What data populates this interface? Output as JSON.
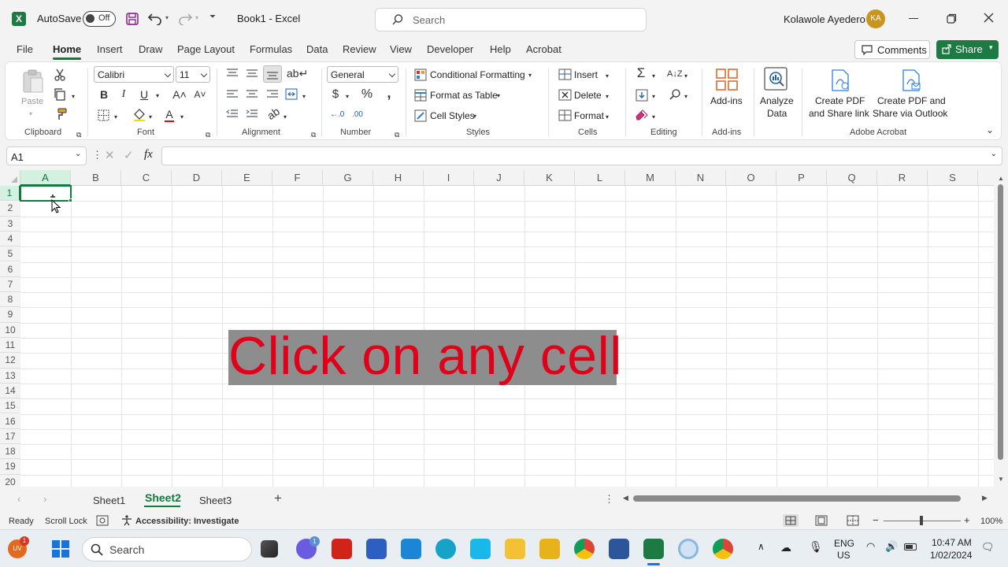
{
  "titlebar": {
    "autosave_label": "AutoSave",
    "autosave_state": "Off",
    "doc_title": "Book1  -  Excel",
    "search_placeholder": "Search",
    "user_name": "Kolawole Ayedero",
    "user_initials": "KA"
  },
  "tabs": [
    "File",
    "Home",
    "Insert",
    "Draw",
    "Page Layout",
    "Formulas",
    "Data",
    "Review",
    "View",
    "Developer",
    "Help",
    "Acrobat"
  ],
  "active_tab": "Home",
  "actions": {
    "comments": "Comments",
    "share": "Share"
  },
  "ribbon": {
    "clipboard": {
      "paste": "Paste",
      "label": "Clipboard"
    },
    "font": {
      "name": "Calibri",
      "size": "11",
      "label": "Font"
    },
    "alignment": {
      "label": "Alignment"
    },
    "number": {
      "format": "General",
      "label": "Number"
    },
    "styles": {
      "conditional": "Conditional Formatting",
      "format_table": "Format as Table",
      "cell_styles": "Cell Styles",
      "label": "Styles"
    },
    "cells": {
      "insert": "Insert",
      "delete": "Delete",
      "format": "Format",
      "label": "Cells"
    },
    "editing": {
      "label": "Editing"
    },
    "addins": {
      "button": "Add-ins",
      "label": "Add-ins"
    },
    "analyze": {
      "line1": "Analyze",
      "line2": "Data"
    },
    "acrobat": {
      "pdf_link_1": "Create PDF",
      "pdf_link_2": "and Share link",
      "pdf_outlook_1": "Create PDF and",
      "pdf_outlook_2": "Share via Outlook",
      "label": "Adobe Acrobat"
    }
  },
  "formula_bar": {
    "name_box": "A1",
    "fx": "fx",
    "value": ""
  },
  "grid": {
    "columns": [
      "A",
      "B",
      "C",
      "D",
      "E",
      "F",
      "G",
      "H",
      "I",
      "J",
      "K",
      "L",
      "M",
      "N",
      "O",
      "P",
      "Q",
      "R",
      "S"
    ],
    "rows": [
      "1",
      "2",
      "3",
      "4",
      "5",
      "6",
      "7",
      "8",
      "9",
      "10",
      "11",
      "12",
      "13",
      "14",
      "15",
      "16",
      "17",
      "18",
      "19",
      "20"
    ],
    "selected_cell": "A1"
  },
  "overlay_text": "Click on any cell",
  "sheets": [
    "Sheet1",
    "Sheet2",
    "Sheet3"
  ],
  "active_sheet": "Sheet2",
  "status": {
    "ready": "Ready",
    "scroll_lock": "Scroll Lock",
    "accessibility": "Accessibility: Investigate",
    "zoom": "100%"
  },
  "taskbar": {
    "search": "Search",
    "lang1": "ENG",
    "lang2": "US",
    "time": "10:47 AM",
    "date": "1/02/2024",
    "weather_badge": "1",
    "chat_badge": "1"
  },
  "colors": {
    "excel_green": "#1d7a43",
    "overlay_text": "#e0001a",
    "overlay_bg": "#8d8d8d"
  }
}
